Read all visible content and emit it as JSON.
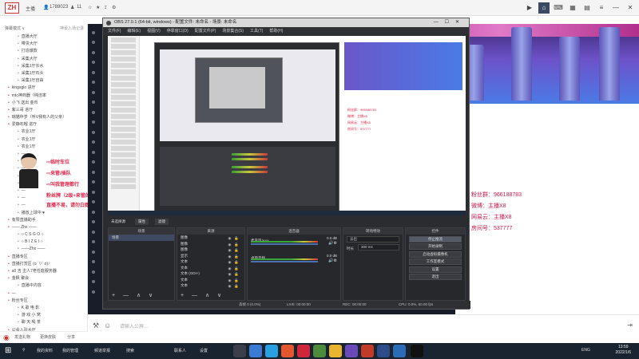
{
  "topbar": {
    "logo": "ZH",
    "label_a": "主播",
    "viewers": "1788023",
    "count": "11",
    "icons": [
      "play-icon",
      "home-icon",
      "gamepad-icon",
      "grid-icon",
      "grid2-icon",
      "list-icon",
      "minimize-icon",
      "close-icon"
    ]
  },
  "chat": {
    "header": "弹幕模式 ∨",
    "header_right": "神豪入场记录",
    "items": [
      {
        "text": "直播大厅",
        "indent": true
      },
      {
        "text": "带货大厅",
        "indent": true
      },
      {
        "text": "打造爆款",
        "indent": true
      },
      {
        "text": "采集大厅",
        "indent": true
      },
      {
        "text": "采集1厅长水",
        "indent": true
      },
      {
        "text": "采集1厅石头",
        "indent": true
      },
      {
        "text": "采集1厅自由",
        "indent": true
      },
      {
        "text": "kingsglo 进厅",
        "indent": false
      },
      {
        "text": "mtc神商器（纯洁率",
        "indent": false
      },
      {
        "text": "小飞 送出 金币",
        "indent": false
      },
      {
        "text": "紫三哥 进厅",
        "indent": false
      },
      {
        "text": "瑞猫伴岁（听V我有人的父亲）",
        "indent": false
      },
      {
        "text": "爱静石榴 进厅",
        "indent": false
      },
      {
        "text": "农业1厅",
        "indent": true
      },
      {
        "text": "农业1厅",
        "indent": true
      },
      {
        "text": "农业1厅",
        "indent": true
      },
      {
        "text": "—",
        "indent": true
      },
      {
        "text": "—",
        "indent": true
      },
      {
        "text": "—",
        "indent": true
      },
      {
        "text": "—",
        "indent": true
      },
      {
        "text": "—",
        "indent": true
      },
      {
        "text": "—",
        "indent": true
      },
      {
        "text": "—",
        "indent": true
      },
      {
        "text": "—",
        "indent": true
      },
      {
        "text": "播放上球中 ♥",
        "indent": true
      },
      {
        "text": "有赞直播助手",
        "indent": false
      },
      {
        "text": "—— Zhx ——",
        "indent": false
      },
      {
        "text": "○  C  S  G  O  ○",
        "indent": true
      },
      {
        "text": "○  B  I  Z  E  I  ○",
        "indent": true
      },
      {
        "text": "——Zhx ——",
        "indent": true
      },
      {
        "text": "直播专区",
        "indent": false
      },
      {
        "text": "直播打赏区 (o ´▽` o)ﾉ",
        "indent": false
      },
      {
        "text": "a0 吉 主人7老任庭服务器",
        "indent": false
      },
      {
        "text": "金枫 聚会",
        "indent": false
      },
      {
        "text": "直播中内容",
        "indent": true
      },
      {
        "text": "—",
        "indent": false
      },
      {
        "text": "粉丝专区",
        "indent": false
      },
      {
        "text": "K 歌  电  影",
        "indent": true
      },
      {
        "text": "游 戏 小 窝",
        "indent": true
      },
      {
        "text": "聊 天 喝 茶",
        "indent": true
      },
      {
        "text": "公会入驻大厅",
        "indent": false
      },
      {
        "text": "与好友…，再也见人要救那",
        "indent": false
      }
    ],
    "promos": [
      "⇨临时车位",
      "⇨来管/插队",
      "⇨叫我管理都行",
      "粉丝牌（2级+来管的正好",
      "直播不易，请勿白嫖"
    ],
    "footer": [
      "发送礼物",
      "更换皮肤",
      "分享"
    ]
  },
  "main": {
    "right_panel": [
      {
        "icon": "fans-icon",
        "text": "粉丝群：966188783"
      },
      {
        "icon": "weibo-icon",
        "text": "微博：主播X8"
      },
      {
        "icon": "netease-icon",
        "text": "网易云：主播X8"
      },
      {
        "icon": "room-icon",
        "text": "房间号：537777"
      }
    ]
  },
  "obs": {
    "title": "OBS 27.0.1 (64-bit, windows) - 配置文件: 未命名 - 场景: 未命名",
    "menu": [
      "文件(F)",
      "编辑(E)",
      "视图(V)",
      "停靠窗口(D)",
      "配置文件(P)",
      "场景集合(S)",
      "工具(T)",
      "帮助(H)"
    ],
    "tabs": [
      "场景",
      "来源",
      "混音器",
      "转场特效",
      "控件"
    ],
    "toolbar": [
      "属性",
      "滤镜"
    ],
    "scenes_header": "场景",
    "scenes": [
      "场景"
    ],
    "sources_header": "来源",
    "sources": [
      "图像",
      "图像",
      "图像",
      "显示",
      "文本",
      "文本",
      "文本 (GDI+)",
      "文本",
      "文本"
    ],
    "mixer_header": "混音器",
    "mixer": [
      {
        "name": "麦克风/Aux",
        "db": "0.0 dB"
      },
      {
        "name": "桌面音频",
        "db": "0.0 dB"
      }
    ],
    "transition_header": "转场特效",
    "transition_value": "淡出",
    "duration_label": "时长",
    "duration_value": "300 ms",
    "controls_header": "控件",
    "controls": [
      "停止推流",
      "开始录制",
      "启动虚拟摄像机",
      "工作室模式",
      "设置",
      "退出"
    ],
    "status": {
      "drop": "丢帧 0 (0.0%)",
      "live": "LIVE: 00:00:00",
      "rec": "REC: 00:00:00",
      "cpu": "CPU: 0.0%, 60.00 fps"
    },
    "preview_red": [
      "粉丝群：966188783",
      "微博：主播X8",
      "网易云：主播X8",
      "房间号：537777"
    ]
  },
  "input": {
    "placeholder": "请输入公屏..."
  },
  "taskbar": {
    "items": [
      "我的资料",
      "我的管理",
      "频道举报",
      "搜索",
      "联系人",
      "设置"
    ],
    "tray": "ENG",
    "time": "13:59",
    "date": "2022/1/6"
  },
  "colors": {
    "accent": "#3a4a63",
    "promo_red": "#e0284c",
    "obs_bg": "#2a2c30"
  }
}
